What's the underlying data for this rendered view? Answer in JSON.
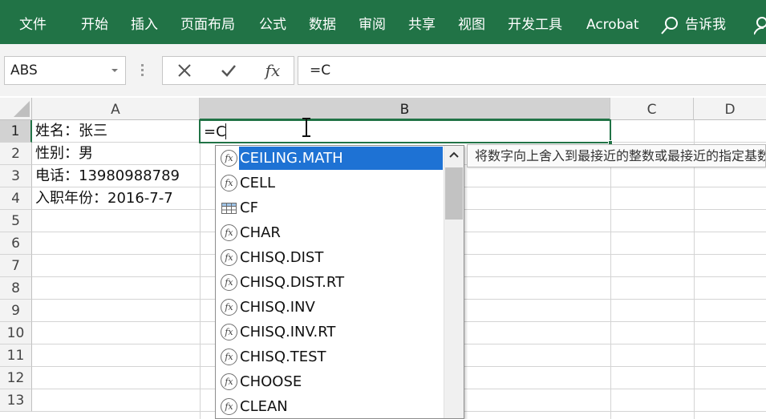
{
  "ribbon": {
    "tabs": [
      "文件",
      "开始",
      "插入",
      "页面布局",
      "公式",
      "数据",
      "审阅",
      "共享",
      "视图",
      "开发工具",
      "Acrobat"
    ],
    "tell_me": "告诉我",
    "color": "#217346"
  },
  "formula_bar": {
    "name_box": "ABS",
    "formula": "=C",
    "cancel_icon": "x-cancel-icon",
    "enter_icon": "checkmark-enter-icon",
    "insert_function_label": "fx"
  },
  "grid": {
    "columns": [
      "A",
      "B",
      "C",
      "D"
    ],
    "rows": [
      "1",
      "2",
      "3",
      "4",
      "5",
      "6",
      "7",
      "8",
      "9",
      "10",
      "11",
      "12",
      "13"
    ],
    "cells_a": [
      "姓名：张三",
      "性别：男",
      "电话：13980988789",
      "入职年份：2016-7-7"
    ],
    "active_cell_value": "=C"
  },
  "autocomplete": {
    "items": [
      {
        "label": "CEILING.MATH",
        "icon": "function-icon",
        "selected": true
      },
      {
        "label": "CELL",
        "icon": "function-icon",
        "selected": false
      },
      {
        "label": "CF",
        "icon": "table-name-icon",
        "selected": false
      },
      {
        "label": "CHAR",
        "icon": "function-icon",
        "selected": false
      },
      {
        "label": "CHISQ.DIST",
        "icon": "function-icon",
        "selected": false
      },
      {
        "label": "CHISQ.DIST.RT",
        "icon": "function-icon",
        "selected": false
      },
      {
        "label": "CHISQ.INV",
        "icon": "function-icon",
        "selected": false
      },
      {
        "label": "CHISQ.INV.RT",
        "icon": "function-icon",
        "selected": false
      },
      {
        "label": "CHISQ.TEST",
        "icon": "function-icon",
        "selected": false
      },
      {
        "label": "CHOOSE",
        "icon": "function-icon",
        "selected": false
      },
      {
        "label": "CLEAN",
        "icon": "function-icon",
        "selected": false
      }
    ],
    "tooltip": "将数字向上舍入到最接近的整数或最接近的指定基数的倍数",
    "fx_glyph": "fx",
    "selection_color": "#1e72d4"
  }
}
